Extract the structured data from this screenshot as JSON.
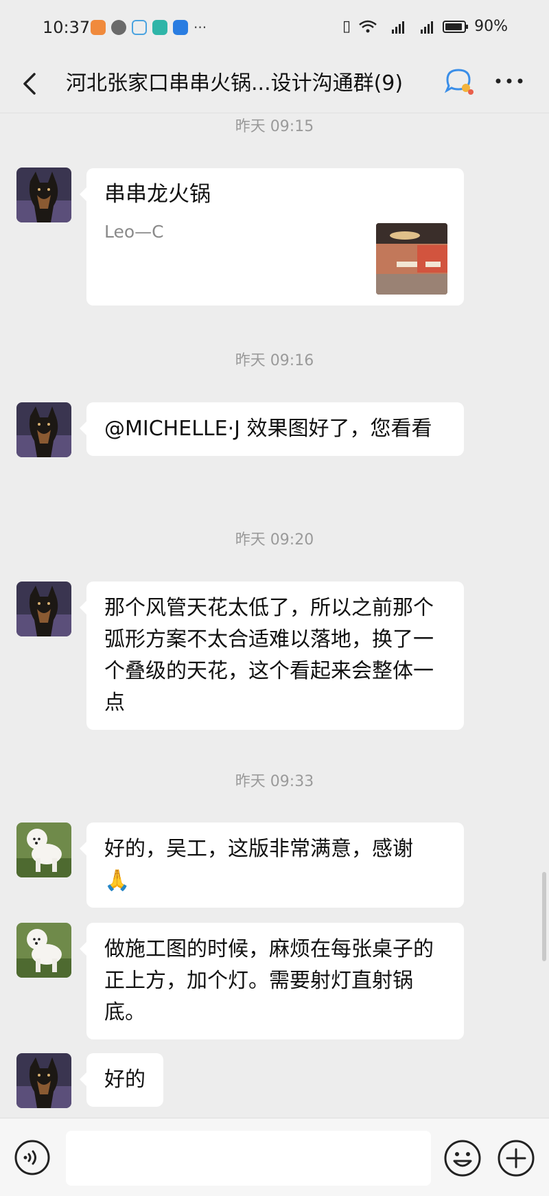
{
  "status_bar": {
    "time": "10:37",
    "network": "5G 4G",
    "battery": "90%"
  },
  "header": {
    "title": "河北张家口串串火锅...设计沟通群(9)",
    "icons": [
      "back-icon",
      "group-chat-icon",
      "more-icon"
    ]
  },
  "messages": [
    {
      "timestamp": "昨天 09:15"
    },
    {
      "type": "card",
      "sender": "dog-avatar",
      "title": "串串龙火锅",
      "source": "Leo—C"
    },
    {
      "timestamp": "昨天 09:16"
    },
    {
      "type": "text",
      "sender": "dog-avatar",
      "text": "@MICHELLE·J 效果图好了，您看看"
    },
    {
      "timestamp": "昨天 09:20"
    },
    {
      "type": "text",
      "sender": "dog-avatar",
      "text": "那个风管天花太低了，所以之前那个弧形方案不太合适难以落地，换了一个叠级的天花，这个看起来会整体一点"
    },
    {
      "timestamp": "昨天 09:33"
    },
    {
      "type": "text",
      "sender": "poodle-avatar",
      "text": "好的，吴工，这版非常满意，感谢",
      "emoji": "🙏"
    },
    {
      "type": "text",
      "sender": "poodle-avatar",
      "text": "做施工图的时候，麻烦在每张桌子的正上方，加个灯。需要射灯直射锅底。"
    },
    {
      "type": "text",
      "sender": "dog-avatar",
      "text": "好的"
    }
  ],
  "colors": {
    "background": "#ededed",
    "bubble": "#ffffff",
    "timestamp": "#9a9a9a"
  }
}
